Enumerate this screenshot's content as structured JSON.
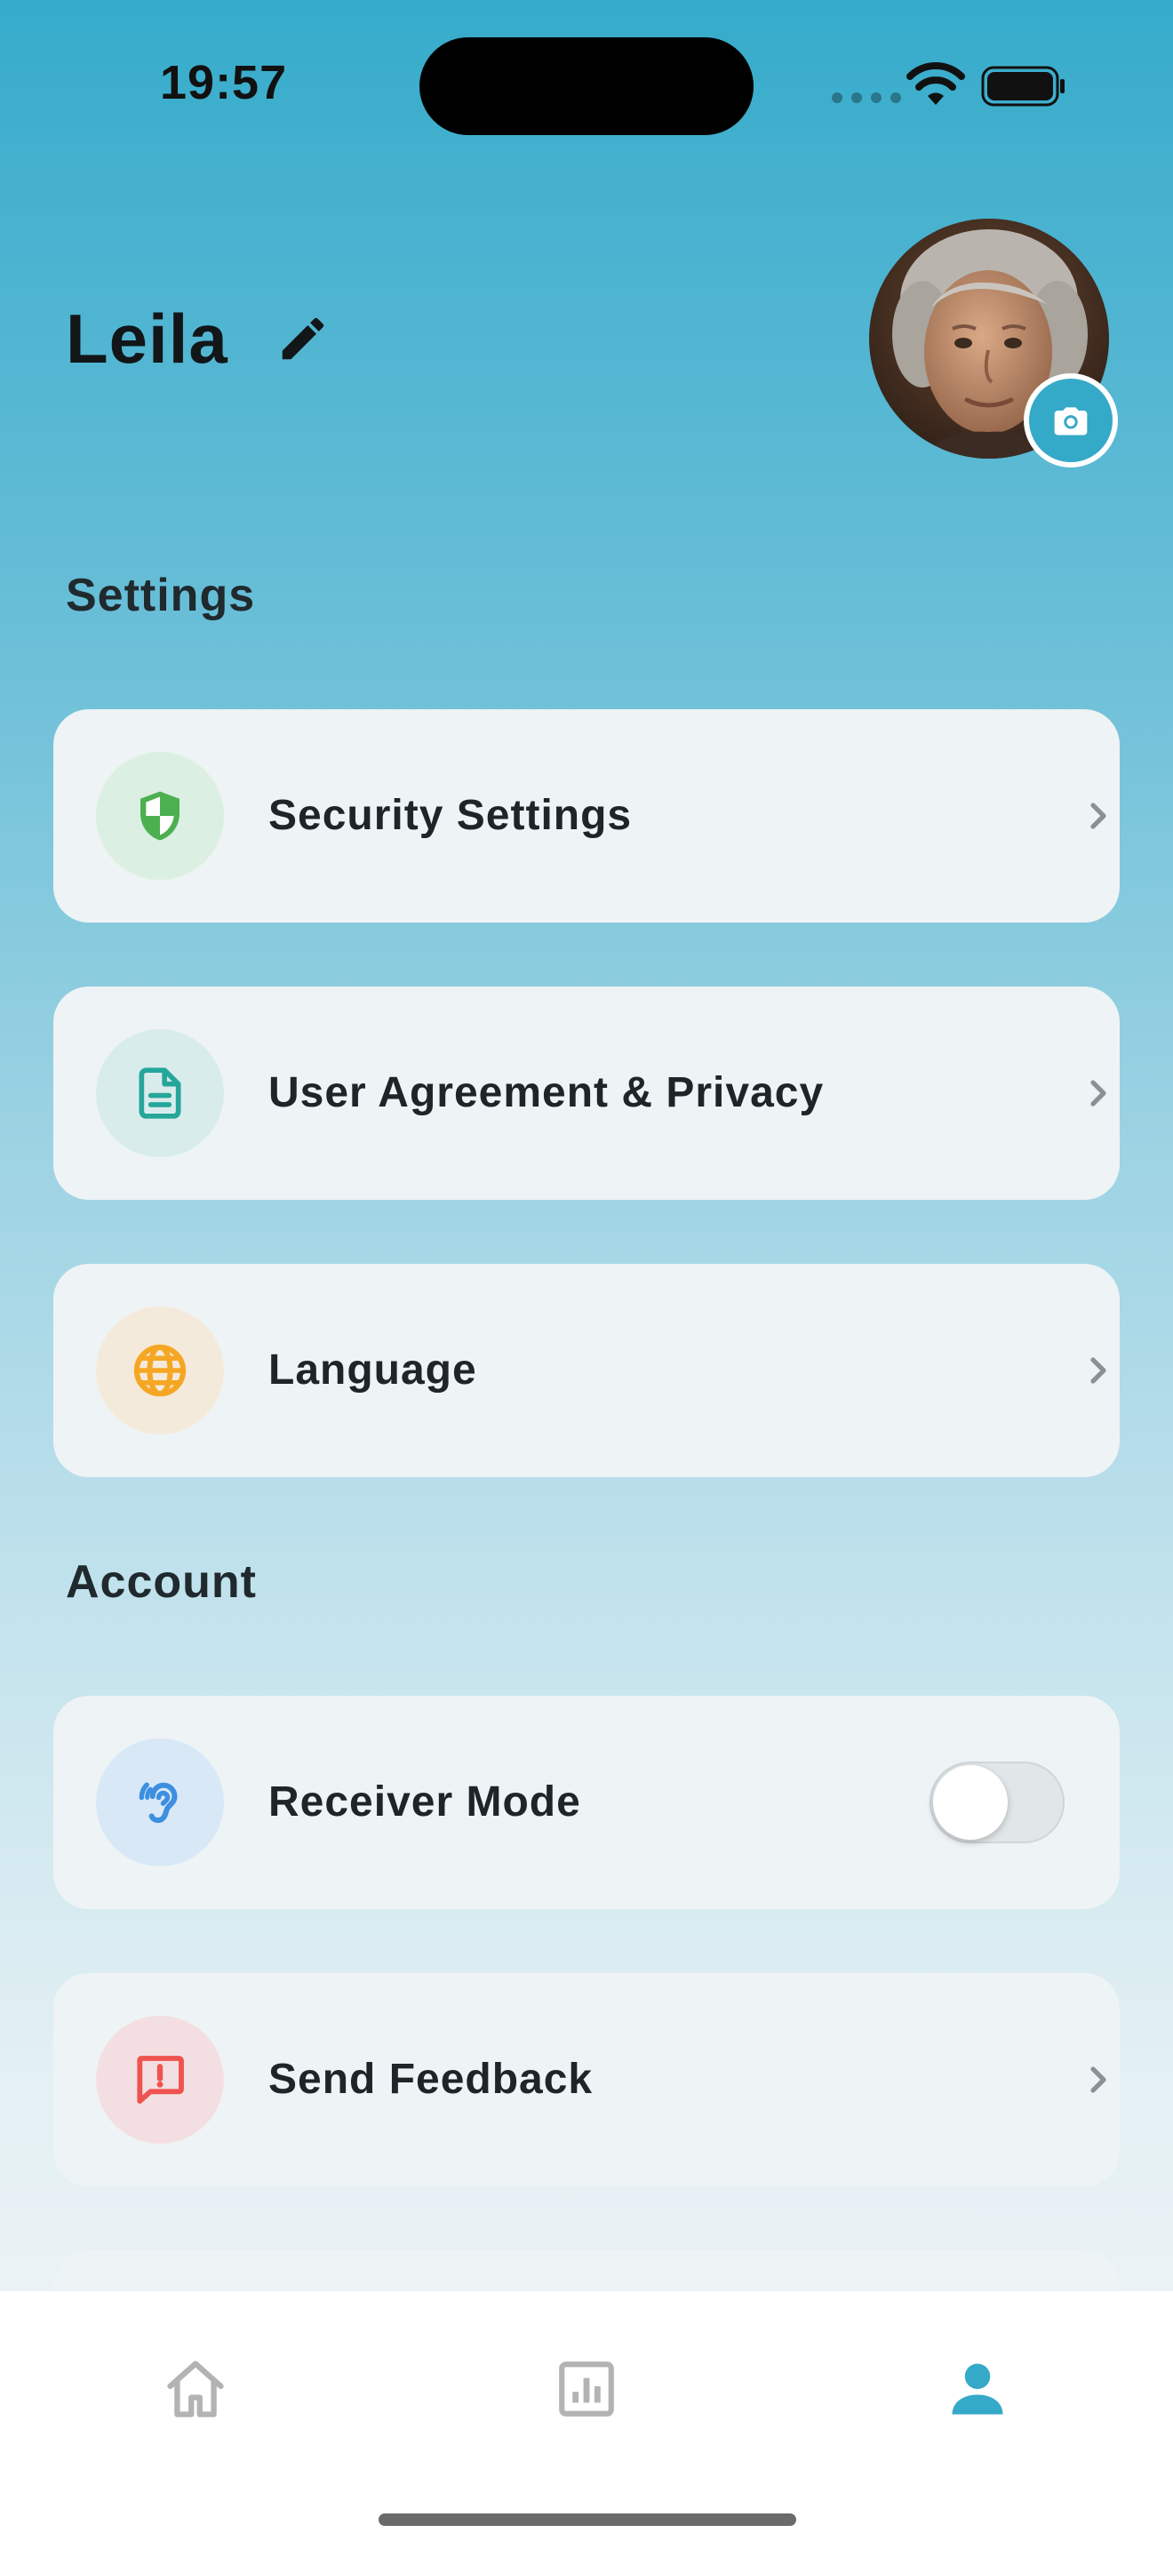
{
  "status_bar": {
    "time": "19:57"
  },
  "profile": {
    "name": "Leila"
  },
  "sections": {
    "settings_title": "Settings",
    "account_title": "Account"
  },
  "settings_items": [
    {
      "label": "Security Settings",
      "icon": "shield-icon",
      "color": "#4caf50"
    },
    {
      "label": "User Agreement & Privacy",
      "icon": "document-icon",
      "color": "#26a69a"
    },
    {
      "label": "Language",
      "icon": "globe-icon",
      "color": "#f5a623"
    }
  ],
  "account_items": [
    {
      "label": "Receiver Mode",
      "icon": "ear-icon",
      "color": "#3d8fe0",
      "toggle_on": false
    },
    {
      "label": "Send Feedback",
      "icon": "feedback-icon",
      "color": "#ef5350"
    }
  ],
  "bottom_nav": {
    "items": [
      {
        "icon": "home-icon",
        "active": false
      },
      {
        "icon": "stats-icon",
        "active": false
      },
      {
        "icon": "profile-icon",
        "active": true
      }
    ],
    "active_color": "#35a9c8",
    "inactive_color": "#b3b3b3"
  },
  "colors": {
    "accent": "#35a9c8",
    "card_background": "#eef3f5"
  }
}
